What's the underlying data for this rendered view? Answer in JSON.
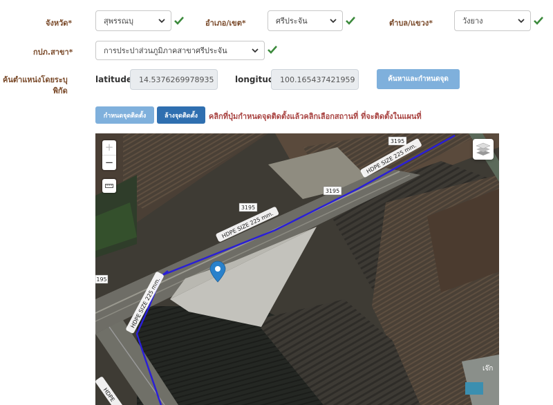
{
  "row1": {
    "province_label": "จังหวัด*",
    "province_value": "สุพรรณบุ",
    "district_label": "อำเภอ/เขต*",
    "district_value": "ศรีประจัน",
    "subdistrict_label": "ตำบล/แขวง*",
    "subdistrict_value": "วังยาง"
  },
  "row2": {
    "branch_label": "กปภ.สาขา*",
    "branch_value": "การประปาส่วนภูมิภาคสาขาศรีประจัน"
  },
  "row3": {
    "search_label_line1": "ค้นตำแหน่งโดยระบุ",
    "search_label_line2": "พิกัด",
    "latitude_label": "latitude",
    "latitude_value": "14.5376269978935",
    "longitude_label": "longitude",
    "longitude_value": "100.165437421959",
    "search_button": "ค้นหาและกำหนดจุด"
  },
  "row4": {
    "set_point_button": "กำหนดจุดติดตั้ง",
    "clear_point_button": "ล้างจุดติดตั้ง",
    "instruction": "คลิกที่ปุ่มกำหนดจุดติดตั้งแล้วคลิกเลือกสถานที่ ที่จะติดตั้งในแผนที่"
  },
  "map": {
    "zoom_in": "+",
    "zoom_out": "−",
    "road_number": "3195",
    "road_number_edge": "195",
    "pipe_label": "HDPE SIZE 225 mm.",
    "place_label": "เจ๊ก",
    "pipe_color": "#2a1fd6",
    "marker_color": "#2a81cb"
  },
  "colors": {
    "label": "#7a4a2a",
    "check": "#3c8a3c",
    "btn_light": "#7fb0dc",
    "btn_dark": "#2f6fb0",
    "hint": "#a94442"
  }
}
